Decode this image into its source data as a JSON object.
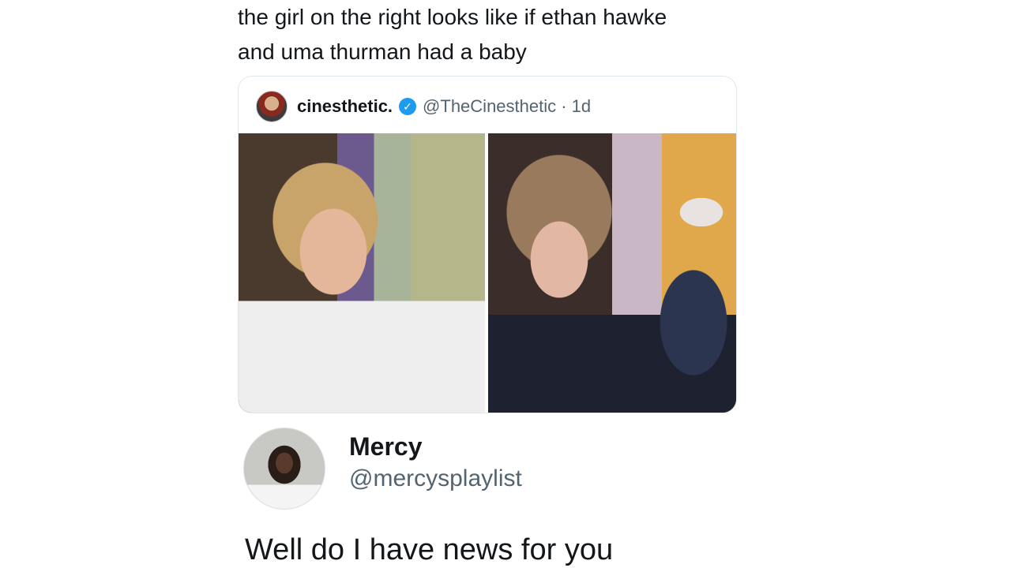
{
  "tweet": {
    "text_line1": "the girl on the right looks like if ethan hawke",
    "text_line2": "and uma thurman had a baby"
  },
  "quote": {
    "name": "cinesthetic.",
    "verified_icon": "verified-badge-icon",
    "handle_time": "@TheCinesthetic · 1d"
  },
  "reply": {
    "name": "Mercy",
    "handle": "@mercysplaylist",
    "text": "Well do I have news for you"
  },
  "colors": {
    "verified": "#1d9bf0",
    "handle": "#536471",
    "text": "#14171a"
  }
}
